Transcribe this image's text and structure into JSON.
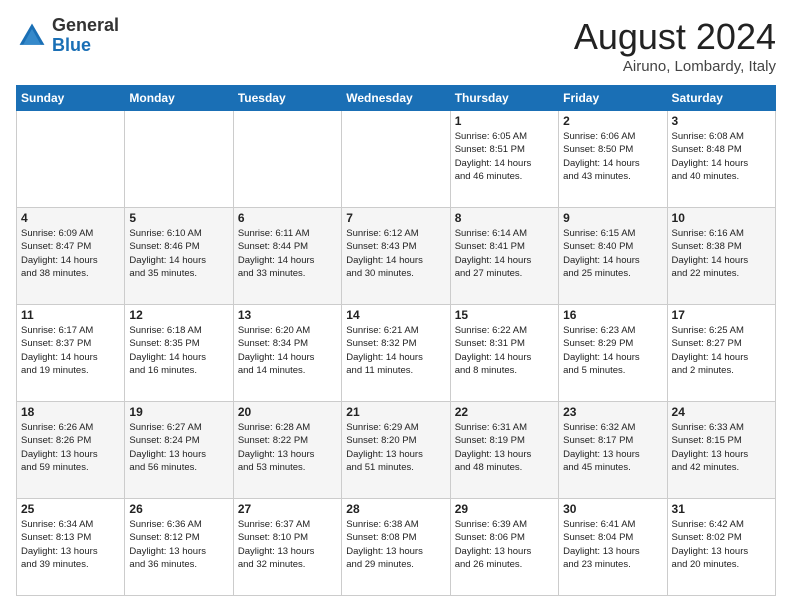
{
  "header": {
    "logo_general": "General",
    "logo_blue": "Blue",
    "month_title": "August 2024",
    "location": "Airuno, Lombardy, Italy"
  },
  "weekdays": [
    "Sunday",
    "Monday",
    "Tuesday",
    "Wednesday",
    "Thursday",
    "Friday",
    "Saturday"
  ],
  "weeks": [
    [
      {
        "day": "",
        "info": ""
      },
      {
        "day": "",
        "info": ""
      },
      {
        "day": "",
        "info": ""
      },
      {
        "day": "",
        "info": ""
      },
      {
        "day": "1",
        "info": "Sunrise: 6:05 AM\nSunset: 8:51 PM\nDaylight: 14 hours\nand 46 minutes."
      },
      {
        "day": "2",
        "info": "Sunrise: 6:06 AM\nSunset: 8:50 PM\nDaylight: 14 hours\nand 43 minutes."
      },
      {
        "day": "3",
        "info": "Sunrise: 6:08 AM\nSunset: 8:48 PM\nDaylight: 14 hours\nand 40 minutes."
      }
    ],
    [
      {
        "day": "4",
        "info": "Sunrise: 6:09 AM\nSunset: 8:47 PM\nDaylight: 14 hours\nand 38 minutes."
      },
      {
        "day": "5",
        "info": "Sunrise: 6:10 AM\nSunset: 8:46 PM\nDaylight: 14 hours\nand 35 minutes."
      },
      {
        "day": "6",
        "info": "Sunrise: 6:11 AM\nSunset: 8:44 PM\nDaylight: 14 hours\nand 33 minutes."
      },
      {
        "day": "7",
        "info": "Sunrise: 6:12 AM\nSunset: 8:43 PM\nDaylight: 14 hours\nand 30 minutes."
      },
      {
        "day": "8",
        "info": "Sunrise: 6:14 AM\nSunset: 8:41 PM\nDaylight: 14 hours\nand 27 minutes."
      },
      {
        "day": "9",
        "info": "Sunrise: 6:15 AM\nSunset: 8:40 PM\nDaylight: 14 hours\nand 25 minutes."
      },
      {
        "day": "10",
        "info": "Sunrise: 6:16 AM\nSunset: 8:38 PM\nDaylight: 14 hours\nand 22 minutes."
      }
    ],
    [
      {
        "day": "11",
        "info": "Sunrise: 6:17 AM\nSunset: 8:37 PM\nDaylight: 14 hours\nand 19 minutes."
      },
      {
        "day": "12",
        "info": "Sunrise: 6:18 AM\nSunset: 8:35 PM\nDaylight: 14 hours\nand 16 minutes."
      },
      {
        "day": "13",
        "info": "Sunrise: 6:20 AM\nSunset: 8:34 PM\nDaylight: 14 hours\nand 14 minutes."
      },
      {
        "day": "14",
        "info": "Sunrise: 6:21 AM\nSunset: 8:32 PM\nDaylight: 14 hours\nand 11 minutes."
      },
      {
        "day": "15",
        "info": "Sunrise: 6:22 AM\nSunset: 8:31 PM\nDaylight: 14 hours\nand 8 minutes."
      },
      {
        "day": "16",
        "info": "Sunrise: 6:23 AM\nSunset: 8:29 PM\nDaylight: 14 hours\nand 5 minutes."
      },
      {
        "day": "17",
        "info": "Sunrise: 6:25 AM\nSunset: 8:27 PM\nDaylight: 14 hours\nand 2 minutes."
      }
    ],
    [
      {
        "day": "18",
        "info": "Sunrise: 6:26 AM\nSunset: 8:26 PM\nDaylight: 13 hours\nand 59 minutes."
      },
      {
        "day": "19",
        "info": "Sunrise: 6:27 AM\nSunset: 8:24 PM\nDaylight: 13 hours\nand 56 minutes."
      },
      {
        "day": "20",
        "info": "Sunrise: 6:28 AM\nSunset: 8:22 PM\nDaylight: 13 hours\nand 53 minutes."
      },
      {
        "day": "21",
        "info": "Sunrise: 6:29 AM\nSunset: 8:20 PM\nDaylight: 13 hours\nand 51 minutes."
      },
      {
        "day": "22",
        "info": "Sunrise: 6:31 AM\nSunset: 8:19 PM\nDaylight: 13 hours\nand 48 minutes."
      },
      {
        "day": "23",
        "info": "Sunrise: 6:32 AM\nSunset: 8:17 PM\nDaylight: 13 hours\nand 45 minutes."
      },
      {
        "day": "24",
        "info": "Sunrise: 6:33 AM\nSunset: 8:15 PM\nDaylight: 13 hours\nand 42 minutes."
      }
    ],
    [
      {
        "day": "25",
        "info": "Sunrise: 6:34 AM\nSunset: 8:13 PM\nDaylight: 13 hours\nand 39 minutes."
      },
      {
        "day": "26",
        "info": "Sunrise: 6:36 AM\nSunset: 8:12 PM\nDaylight: 13 hours\nand 36 minutes."
      },
      {
        "day": "27",
        "info": "Sunrise: 6:37 AM\nSunset: 8:10 PM\nDaylight: 13 hours\nand 32 minutes."
      },
      {
        "day": "28",
        "info": "Sunrise: 6:38 AM\nSunset: 8:08 PM\nDaylight: 13 hours\nand 29 minutes."
      },
      {
        "day": "29",
        "info": "Sunrise: 6:39 AM\nSunset: 8:06 PM\nDaylight: 13 hours\nand 26 minutes."
      },
      {
        "day": "30",
        "info": "Sunrise: 6:41 AM\nSunset: 8:04 PM\nDaylight: 13 hours\nand 23 minutes."
      },
      {
        "day": "31",
        "info": "Sunrise: 6:42 AM\nSunset: 8:02 PM\nDaylight: 13 hours\nand 20 minutes."
      }
    ]
  ]
}
